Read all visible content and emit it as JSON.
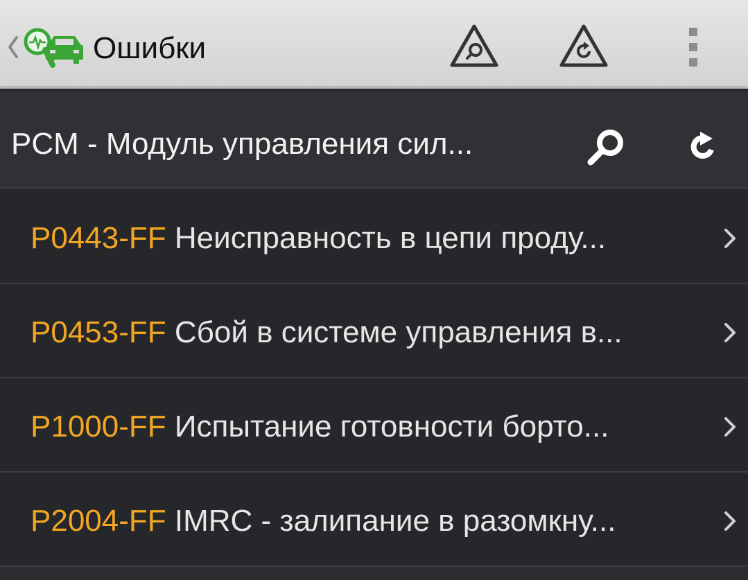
{
  "actionbar": {
    "title": "Ошибки",
    "icons": {
      "back": "chevron-left-icon",
      "logo": "car-diagnostics-icon",
      "search": "warning-search-icon",
      "refresh": "warning-refresh-icon",
      "menu": "overflow-menu-icon"
    }
  },
  "module": {
    "title": "PCM - Модуль управления сил...",
    "icons": {
      "search": "search-icon",
      "refresh": "refresh-icon"
    }
  },
  "faults": [
    {
      "code": "P0443-FF",
      "description": "Неисправность в цепи проду..."
    },
    {
      "code": "P0453-FF",
      "description": "Сбой в системе управления в..."
    },
    {
      "code": "P1000-FF",
      "description": "Испытание готовности борто..."
    },
    {
      "code": "P2004-FF",
      "description": "IMRC - залипание в разомкну..."
    }
  ],
  "colors": {
    "accent_code": "#f3a622",
    "logo_green": "#3aa635",
    "actionbar_bg": "#dcdcdc",
    "list_bg": "#26272b"
  }
}
